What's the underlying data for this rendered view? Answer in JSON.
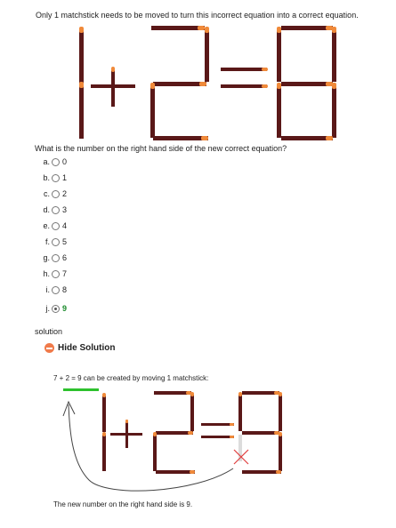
{
  "question": "Only 1 matchstick needs to be moved to turn this incorrect equation into a correct equation.",
  "prompt": "What is the number on the right hand side of the new correct equation?",
  "options": [
    {
      "letter": "a.",
      "value": "0",
      "checked": false
    },
    {
      "letter": "b.",
      "value": "1",
      "checked": false
    },
    {
      "letter": "c.",
      "value": "2",
      "checked": false
    },
    {
      "letter": "d.",
      "value": "3",
      "checked": false
    },
    {
      "letter": "e.",
      "value": "4",
      "checked": false
    },
    {
      "letter": "f.",
      "value": "5",
      "checked": false
    },
    {
      "letter": "g.",
      "value": "6",
      "checked": false
    },
    {
      "letter": "h.",
      "value": "7",
      "checked": false
    },
    {
      "letter": "i.",
      "value": "8",
      "checked": false
    },
    {
      "letter": "j.",
      "value": "9",
      "checked": true
    }
  ],
  "solution_label": "solution",
  "hide_solution_label": "Hide Solution",
  "solution_text": "7 + 2 = 9 can be created by moving 1 matchstick:",
  "solution_result": "The new number on the right hand side is 9.",
  "colors": {
    "stick": "#5a1818",
    "head": "#f08a3a",
    "correct": "#1a8a2a",
    "moved": "#2ec12e",
    "cross": "#e04040"
  },
  "icons": {
    "hide": "minus-circle-icon",
    "radio": "radio-icon",
    "arrow": "curved-arrow-icon",
    "cross": "cross-icon"
  }
}
